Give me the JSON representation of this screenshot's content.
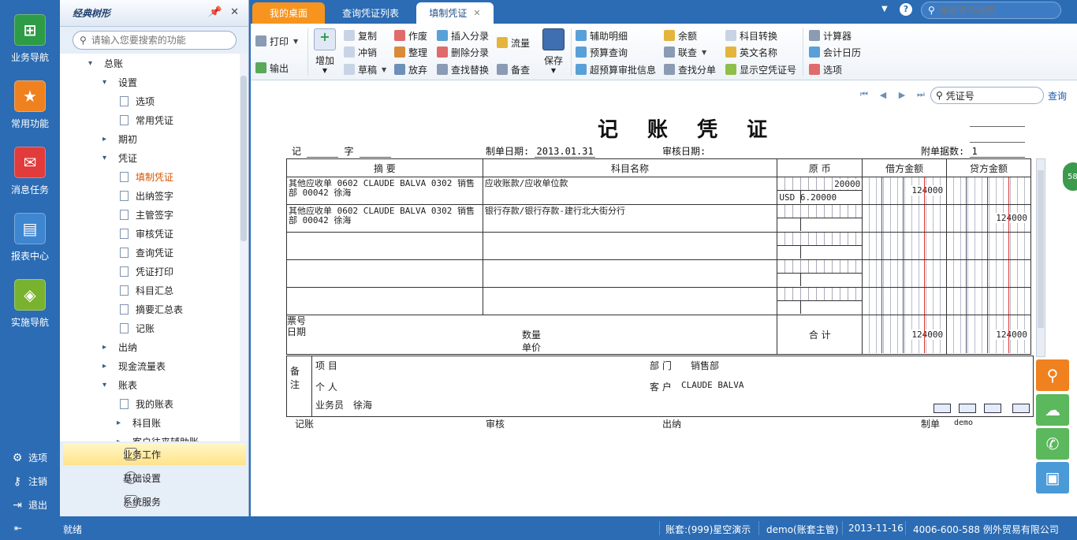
{
  "dock": {
    "items": [
      {
        "label": "业务导航",
        "icon": "business-nav-icon",
        "color": "#2e9b46"
      },
      {
        "label": "常用功能",
        "icon": "star-icon",
        "color": "#f0811f"
      },
      {
        "label": "消息任务",
        "icon": "mail-icon",
        "color": "#e23b3b"
      },
      {
        "label": "报表中心",
        "icon": "report-icon",
        "color": "#3f86d0"
      },
      {
        "label": "实施导航",
        "icon": "compass-icon",
        "color": "#79b22e"
      }
    ],
    "bottom": [
      {
        "label": "选项",
        "icon": "gear-icon"
      },
      {
        "label": "注销",
        "icon": "key-icon"
      },
      {
        "label": "退出",
        "icon": "exit-icon"
      }
    ]
  },
  "tree": {
    "title": "经典树形",
    "search_placeholder": "请输入您要搜索的功能",
    "nodes": [
      {
        "label": "总账",
        "level": 1,
        "type": "open"
      },
      {
        "label": "设置",
        "level": 2,
        "type": "open"
      },
      {
        "label": "选项",
        "level": 3,
        "type": "leaf"
      },
      {
        "label": "常用凭证",
        "level": 3,
        "type": "leaf"
      },
      {
        "label": "期初",
        "level": 2,
        "type": "closed"
      },
      {
        "label": "凭证",
        "level": 2,
        "type": "open"
      },
      {
        "label": "填制凭证",
        "level": 3,
        "type": "leaf",
        "selected": true
      },
      {
        "label": "出纳签字",
        "level": 3,
        "type": "leaf"
      },
      {
        "label": "主管签字",
        "level": 3,
        "type": "leaf"
      },
      {
        "label": "审核凭证",
        "level": 3,
        "type": "leaf"
      },
      {
        "label": "查询凭证",
        "level": 3,
        "type": "leaf"
      },
      {
        "label": "凭证打印",
        "level": 3,
        "type": "leaf"
      },
      {
        "label": "科目汇总",
        "level": 3,
        "type": "leaf"
      },
      {
        "label": "摘要汇总表",
        "level": 3,
        "type": "leaf"
      },
      {
        "label": "记账",
        "level": 3,
        "type": "leaf"
      },
      {
        "label": "出纳",
        "level": 2,
        "type": "closed"
      },
      {
        "label": "现金流量表",
        "level": 2,
        "type": "closed"
      },
      {
        "label": "账表",
        "level": 2,
        "type": "open"
      },
      {
        "label": "我的账表",
        "level": 3,
        "type": "leaf"
      },
      {
        "label": "科目账",
        "level": 3,
        "type": "closed"
      },
      {
        "label": "客户往来辅助账",
        "level": 3,
        "type": "closed"
      }
    ],
    "bottom": [
      {
        "label": "业务工作",
        "active": true
      },
      {
        "label": "基础设置",
        "active": false
      },
      {
        "label": "系统服务",
        "active": false
      }
    ]
  },
  "tabs": [
    {
      "label": "我的桌面",
      "kind": "home"
    },
    {
      "label": "查询凭证列表",
      "kind": "normal"
    },
    {
      "label": "填制凭证",
      "kind": "active"
    }
  ],
  "top_search_placeholder": "单据条码搜索",
  "toolbar": {
    "print": "打印",
    "export": "输出",
    "add": "增加",
    "copy": "复制",
    "reverse": "冲销",
    "draft": "草稿",
    "void": "作废",
    "arrange": "整理",
    "abandon": "放弃",
    "insert_entry": "插入分录",
    "delete_entry": "删除分录",
    "find_replace": "查找替换",
    "cashflow": "流量",
    "memo": "备查",
    "save": "保存",
    "aux_detail": "辅助明细",
    "budget_query": "预算查询",
    "over_budget": "超预算审批信息",
    "balance": "余额",
    "linked_query": "联查",
    "find_split": "查找分单",
    "subject_convert": "科目转换",
    "english_name": "英文名称",
    "show_blank": "显示空凭证号",
    "calculator": "计算器",
    "calendar": "会计日历",
    "options": "选项"
  },
  "voucher": {
    "title": "记 账 凭 证",
    "search_value": "凭证号",
    "query_label": "查询",
    "type_label": "记",
    "zi_label": "字",
    "make_date_label": "制单日期:",
    "make_date": "2013.01.31",
    "audit_date_label": "审核日期:",
    "attachments_label": "附单据数:",
    "attachments": "1",
    "headers": {
      "summary": "摘 要",
      "subject": "科目名称",
      "original": "原 币",
      "debit": "借方金额",
      "credit": "贷方金额"
    },
    "rows": [
      {
        "summary": "其他应收单 0602 CLAUDE BALVA 0302 销售部 00042 徐海",
        "subject": "应收账款/应收单位款",
        "orig_amount": "20000",
        "orig_currency": "USD 6.20000",
        "debit": "124000",
        "credit": ""
      },
      {
        "summary": "其他应收单 0602 CLAUDE BALVA 0302 销售部 00042 徐海",
        "subject": "银行存款/银行存款-建行北大街分行",
        "orig_amount": "",
        "orig_currency": "",
        "debit": "",
        "credit": "124000"
      },
      {
        "summary": "",
        "subject": "",
        "orig_amount": "",
        "orig_currency": "",
        "debit": "",
        "credit": ""
      },
      {
        "summary": "",
        "subject": "",
        "orig_amount": "",
        "orig_currency": "",
        "debit": "",
        "credit": ""
      },
      {
        "summary": "",
        "subject": "",
        "orig_amount": "",
        "orig_currency": "",
        "debit": "",
        "credit": ""
      }
    ],
    "ticket_no_label": "票号",
    "date_label": "日期",
    "qty_label": "数量",
    "price_label": "单价",
    "total_label": "合 计",
    "total_debit": "124000",
    "total_credit": "124000",
    "remarks_label": "备注",
    "project_label": "项 目",
    "dept_label": "部 门",
    "dept_value": "销售部",
    "person_label": "个 人",
    "customer_label": "客 户",
    "customer_value": "CLAUDE BALVA",
    "salesman_label": "业务员",
    "salesman_value": "徐海",
    "sig_post": "记账",
    "sig_audit": "审核",
    "sig_cashier": "出纳",
    "sig_maker": "制单",
    "maker_value": "demo"
  },
  "bubble": "58",
  "status": {
    "ready": "就绪",
    "account": "账套:(999)星空演示",
    "user": "demo(账套主管)",
    "date": "2013-11-16",
    "company": "4006-600-588 例外贸易有限公司"
  },
  "colors": {
    "brand": "#2b6cb4",
    "home_tab": "#f7941d",
    "float": "#5cb85c",
    "search_float": "#f0811f"
  }
}
